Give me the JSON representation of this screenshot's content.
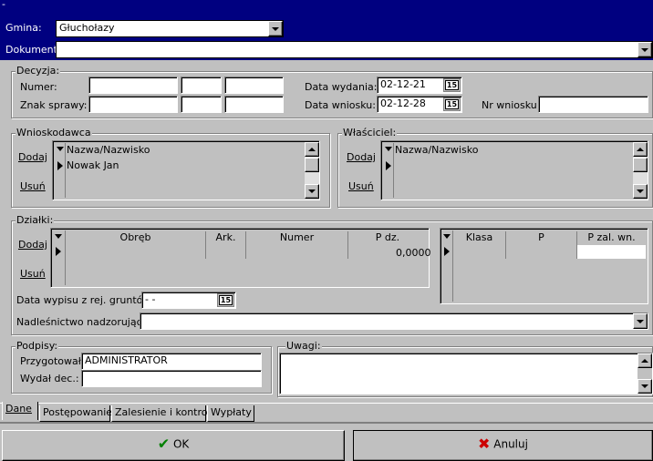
{
  "titlebar": {
    "text": "-"
  },
  "top": {
    "gmina_label": "Gmina:",
    "gmina_value": "Głuchołazy",
    "dokument_label": "Dokument:",
    "dokument_value": ""
  },
  "decyzja": {
    "title": "Decyzja:",
    "numer_label": "Numer:",
    "znak_label": "Znak sprawy:",
    "data_wydania_label": "Data wydania:",
    "data_wydania_value": "02-12-21",
    "data_wniosku_label": "Data wniosku:",
    "data_wniosku_value": "02-12-28",
    "nr_wniosku_label": "Nr wniosku:",
    "calendar_icon_text": "15"
  },
  "wnioskodawca": {
    "title": "Wnioskodawca",
    "dodaj": "Dodaj",
    "usun": "Usuń",
    "header": "Nazwa/Nazwisko",
    "rows": [
      "Nowak Jan"
    ]
  },
  "wlasciciel": {
    "title": "Właściciel:",
    "dodaj": "Dodaj",
    "usun": "Usuń",
    "header": "Nazwa/Nazwisko"
  },
  "dzialki": {
    "title": "Działki:",
    "dodaj": "Dodaj",
    "usun": "Usuń",
    "columns": [
      "Obręb",
      "Ark.",
      "Numer",
      "P dz."
    ],
    "pdz_value": "0,0000",
    "klasa_columns": [
      "Klasa",
      "P",
      "P zal. wn."
    ],
    "data_wypisu_label": "Data wypisu z rej. gruntów:",
    "data_wypisu_value": " -  -",
    "nadlesnictwo_label": "Nadleśnictwo nadzorujące:",
    "nadlesnictwo_value": ""
  },
  "podpisy": {
    "title": "Podpisy:",
    "przygotowal_label": "Przygotował:",
    "przygotowal_value": "ADMINISTRATOR",
    "wydal_label": "Wydał dec.:",
    "wydal_value": ""
  },
  "uwagi": {
    "title": "Uwagi:",
    "value": ""
  },
  "tabs": [
    {
      "label": "Dane",
      "active": true
    },
    {
      "label": "Postępowanie",
      "active": false
    },
    {
      "label": "Zalesienie i kontrole",
      "active": false
    },
    {
      "label": "Wypłaty",
      "active": false
    }
  ],
  "buttons": {
    "ok": "OK",
    "cancel": "Anuluj"
  },
  "colors": {
    "titlebar": "#000080",
    "window": "#c0c0c0",
    "ok_check": "#008000",
    "cancel_x": "#cc0000"
  }
}
